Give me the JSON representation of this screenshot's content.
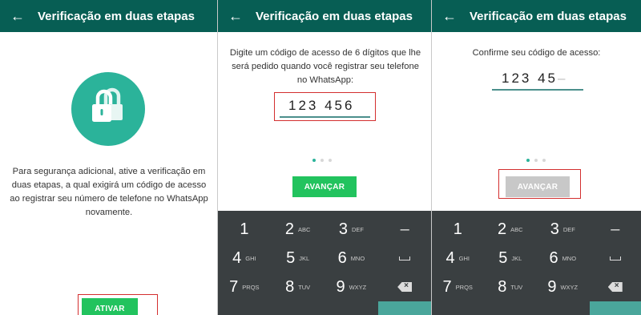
{
  "screens": [
    {
      "title": "Verificação em duas etapas",
      "description": "Para segurança adicional, ative a verificação em duas etapas, a qual exigirá um código de acesso ao registrar seu número de telefone no WhatsApp novamente.",
      "button": "ATIVAR",
      "icon": "lock-icon"
    },
    {
      "title": "Verificação em duas etapas",
      "instruction": "Digite um código de acesso de 6 dígitos que lhe será pedido quando você registrar seu telefone no WhatsApp:",
      "code": "123 456",
      "button": "AVANÇAR",
      "page_indicator": {
        "total": 3,
        "active": 1
      }
    },
    {
      "title": "Verificação em duas etapas",
      "instruction": "Confirme seu código de acesso:",
      "code": "123 45",
      "code_placeholder": "–",
      "button": "AVANÇAR",
      "button_state": "disabled",
      "page_indicator": {
        "total": 3,
        "active": 1
      }
    }
  ],
  "keypad": {
    "keys": [
      {
        "num": "1",
        "letters": ""
      },
      {
        "num": "2",
        "letters": "ABC"
      },
      {
        "num": "3",
        "letters": "DEF"
      },
      {
        "num": "–",
        "letters": ""
      },
      {
        "num": "4",
        "letters": "GHI"
      },
      {
        "num": "5",
        "letters": "JKL"
      },
      {
        "num": "6",
        "letters": "MNO"
      },
      {
        "num": "space",
        "letters": ""
      },
      {
        "num": "7",
        "letters": "PRQS"
      },
      {
        "num": "8",
        "letters": "TUV"
      },
      {
        "num": "9",
        "letters": "WXYZ"
      },
      {
        "num": "backspace",
        "letters": ""
      }
    ]
  },
  "colors": {
    "appbar": "#075e54",
    "accent": "#2bb39a",
    "button": "#22c35e",
    "button_disabled": "#c8c8c8",
    "highlight": "#d32f2f",
    "keypad": "#3a3f41"
  }
}
